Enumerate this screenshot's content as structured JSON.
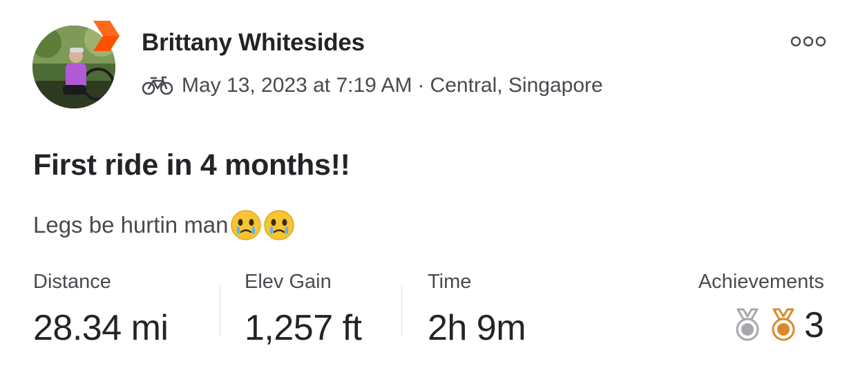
{
  "athlete": {
    "name": "Brittany Whitesides",
    "avatar_icon": "athlete-avatar-photo",
    "badge_icon": "subscriber-badge-icon",
    "badge_color": "#FC5200"
  },
  "activity": {
    "sport_icon": "bike-icon",
    "datetime": "May 13, 2023 at 7:19 AM",
    "separator": "·",
    "location": "Central, Singapore",
    "title": "First ride in 4 months!!",
    "description": "Legs be hurtin man",
    "description_emojis": [
      "face-holding-back-tears-emoji",
      "face-holding-back-tears-emoji"
    ]
  },
  "menu": {
    "more_icon": "more-options-icon"
  },
  "stats": [
    {
      "label": "Distance",
      "value": "28.34 mi"
    },
    {
      "label": "Elev Gain",
      "value": "1,257 ft"
    },
    {
      "label": "Time",
      "value": "2h 9m"
    }
  ],
  "achievements": {
    "label": "Achievements",
    "count": "3",
    "medals": [
      {
        "icon": "silver-medal-icon",
        "color": "#A7A7AB"
      },
      {
        "icon": "bronze-medal-icon",
        "color": "#D9892B"
      }
    ]
  }
}
